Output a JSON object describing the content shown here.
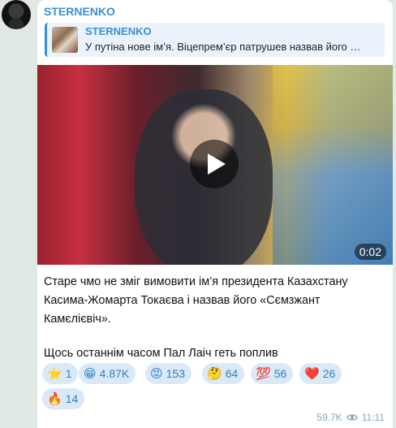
{
  "channel": {
    "name": "STERNENKO"
  },
  "reply": {
    "name": "STERNENKO",
    "text": "У путіна нове ім’я. Віцепрем’єр патрушев назвав його …"
  },
  "video": {
    "duration": "0:02"
  },
  "caption": {
    "paragraph1": "Старе чмо не зміг вимовити ім’я президента Казахстану Касима-Жомарта Токаєва і назвав його «Сємзжант Камєлієвіч».",
    "paragraph2": "Щось останнім часом Пал Лаіч геть поплив"
  },
  "reactions": [
    {
      "icon": "star-icon",
      "emoji": "⭐",
      "count": "1"
    },
    {
      "icon": "grin-icon",
      "emoji": "😁",
      "count": "4.87K"
    },
    {
      "icon": "angry-face-icon",
      "emoji": "😡",
      "count": "153"
    },
    {
      "icon": "thinking-face-icon",
      "emoji": "🤔",
      "count": "64"
    },
    {
      "icon": "hundred-icon",
      "emoji": "💯",
      "count": "56"
    },
    {
      "icon": "heart-icon",
      "emoji": "❤️",
      "count": "26"
    },
    {
      "icon": "fire-icon",
      "emoji": "🔥",
      "count": "14"
    }
  ],
  "meta": {
    "views": "59.7K",
    "time": "11:11"
  },
  "colors": {
    "accent": "#3a8fd2",
    "chip_bg": "#dbe9f7",
    "background": "#dfe8e3"
  }
}
